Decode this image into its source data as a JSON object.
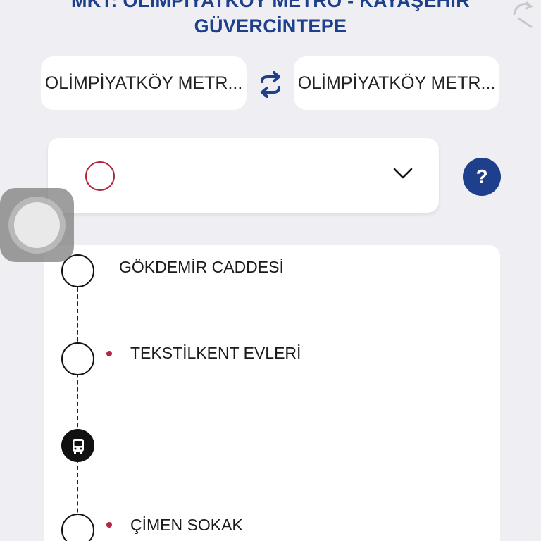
{
  "header": {
    "title_line1": "MKT: OLİMPİYATKÖY METRO - KAYAŞEHİR",
    "title_line2": "GÜVERCİNTEPE",
    "share_icon": "share-icon"
  },
  "route": {
    "from_stop": "OLİMPİYATKÖY METR...",
    "to_stop": "OLİMPİYATKÖY METR...",
    "swap_icon": "swap-arrows-icon"
  },
  "direction_select": {
    "chevron_icon": "chevron-down-icon"
  },
  "help": {
    "label": "?"
  },
  "stops": [
    {
      "name": "GÖKDEMİR CADDESİ",
      "marker": false
    },
    {
      "name": "TEKSTİLKENT EVLERİ",
      "marker": true
    },
    {
      "name": "",
      "bus": true
    },
    {
      "name": "ÇİMEN SOKAK",
      "marker": true
    }
  ],
  "colors": {
    "brand_blue": "#1d3f8c",
    "accent_red": "#b3263c",
    "background": "#efeff3"
  }
}
